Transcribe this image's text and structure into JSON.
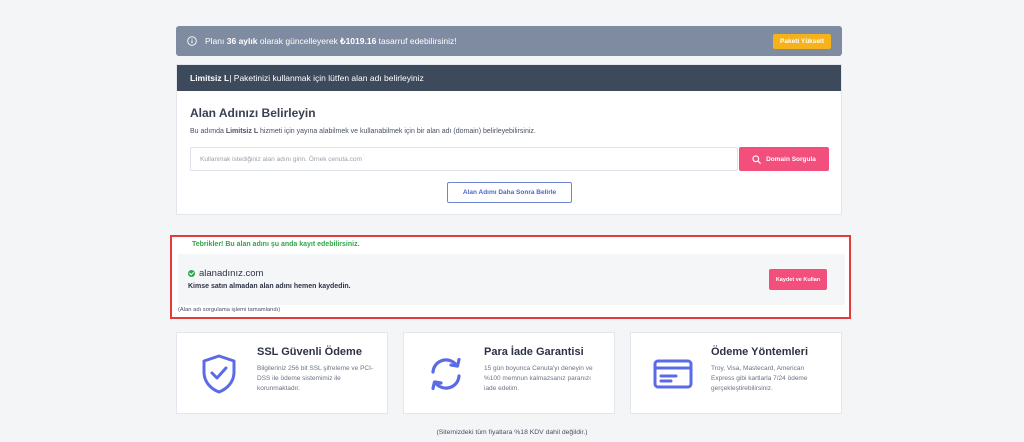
{
  "promo": {
    "text_pre": "Planı ",
    "text_bold1": "36 aylık",
    "text_mid": " olarak güncelleyerek ",
    "text_bold2": "₺1019.16",
    "text_post": " tasarruf edebilirsiniz!",
    "upgrade_label": "Paketi Yükselt",
    "icon": "info-circle-icon"
  },
  "plan_card": {
    "header_plan": "Limitsiz L",
    "header_rest": " | Paketinizi kullanmak için lütfen alan adı belirleyiniz",
    "title": "Alan Adınızı Belirleyin",
    "desc_pre": "Bu adımda ",
    "desc_bold": "Limitsiz L",
    "desc_post": " hizmeti için yayına alabilmek ve kullanabilmek için bir alan adı (domain) belirleyebilirsiniz.",
    "input_placeholder": "Kullanmak istediğiniz alan adını girin. Örnek cenuta.com",
    "search_label": "Domain Sorgula",
    "later_label": "Alan Adımı Daha Sonra Belirle"
  },
  "result": {
    "congrats": "Tebrikler! Bu alan adını şu anda kayıt edebilirsiniz.",
    "domain": "alanadınız.com",
    "subtext": "Kimse satın almadan alan adını hemen kaydedin.",
    "register_label": "Kaydet ve Kullan",
    "status": "(Alan adı sorgulama işlemi tamamlandı)"
  },
  "features": [
    {
      "title": "SSL Güvenli Ödeme",
      "text": "Bilgileriniz 256 bit SSL şifreleme ve PCI-DSS ile ödeme sistemimiz ile korunmaktadır.",
      "icon": "shield-check-icon"
    },
    {
      "title": "Para İade Garantisi",
      "text": "15 gün boyunca Cenuta'yı deneyin ve %100 memnun kalmazsanız paranızı iade edelim.",
      "icon": "refresh-arrows-icon"
    },
    {
      "title": "Ödeme Yöntemleri",
      "text": "Troy, Visa, Mastecard, American Express gibi kartlarla 7/24 ödeme gerçekleştirebilirsiniz.",
      "icon": "credit-card-icon"
    }
  ],
  "footnote": "(Sitemizdeki tüm fiyatlara %18 KDV dahil değildir.)",
  "colors": {
    "accent_pink": "#f24f7c",
    "promo_bg": "#7f8ba1",
    "header_bg": "#3d4a5c",
    "success_green": "#2fa64a",
    "icon_blue": "#5b6be8",
    "upgrade_yellow": "#f5b21b"
  }
}
